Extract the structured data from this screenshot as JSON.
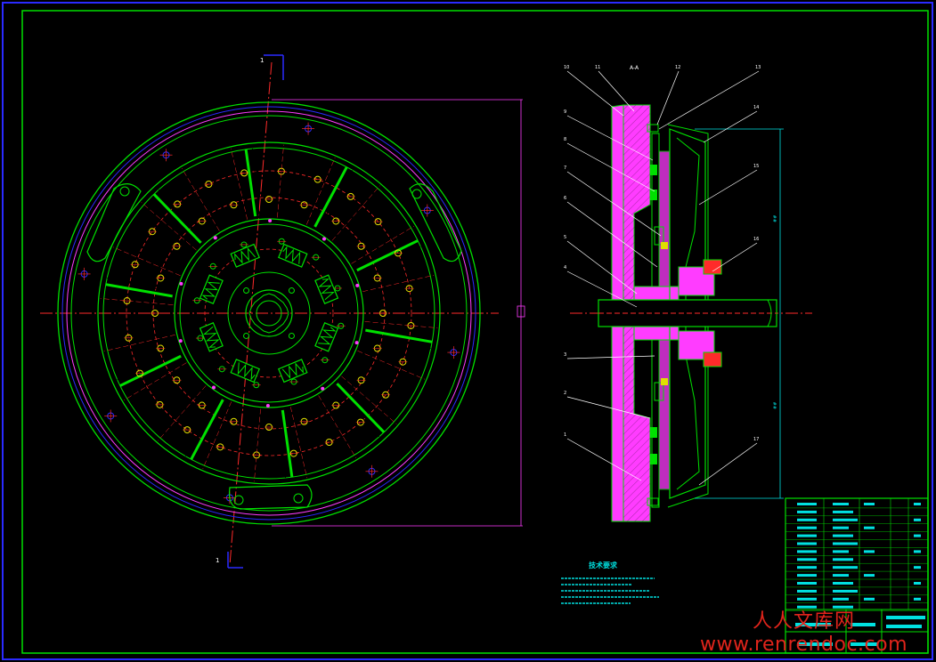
{
  "drawing": {
    "colors": {
      "background": "#000000",
      "frame": "#2a2aff",
      "green": "#00e000",
      "red": "#ff2a2a",
      "magenta": "#ff3cff",
      "cyan": "#00e0e0",
      "white": "#ffffff",
      "yellow": "#e0e000"
    },
    "front_view": {
      "section_label_top": "1",
      "section_label_bottom": "1"
    },
    "side_view": {
      "section_title": "A-A",
      "balloons_top": [
        "10",
        "11",
        "12",
        "13"
      ],
      "balloons_left": [
        "9",
        "8",
        "7",
        "6",
        "5",
        "4",
        "3",
        "2",
        "1"
      ],
      "balloons_right": [
        "14",
        "15",
        "16",
        "17"
      ]
    },
    "notes_title": "技术要求",
    "title_block_cells": 14
  },
  "watermark": {
    "cn": "人人文库网",
    "url": "www.renrendoc.com"
  }
}
